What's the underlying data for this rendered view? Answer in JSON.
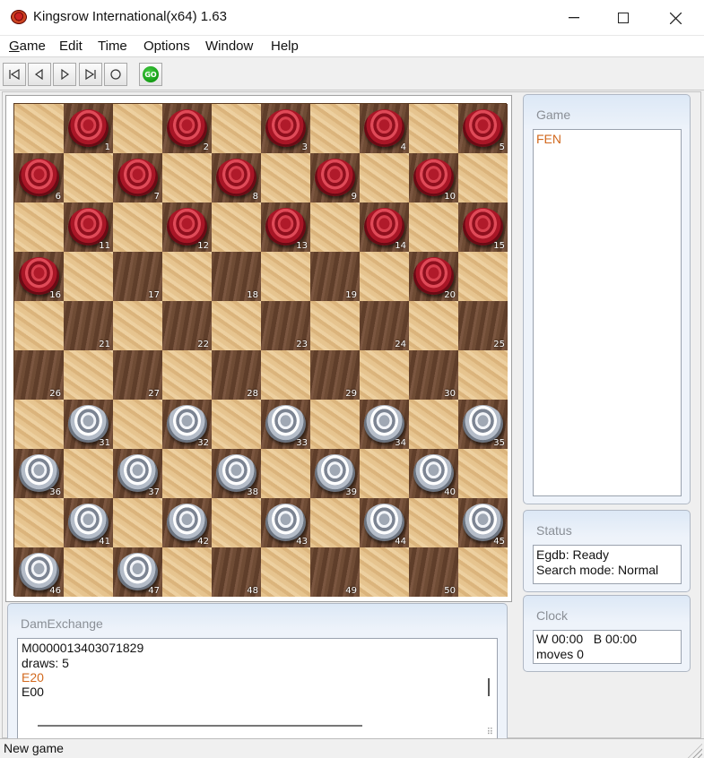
{
  "window": {
    "title": "Kingsrow International(x64) 1.63"
  },
  "menu": [
    "Game",
    "Edit",
    "Time",
    "Options",
    "Window",
    "Help"
  ],
  "toolbar": {
    "go_label": "GO"
  },
  "board": {
    "pieces": {
      "1": "red",
      "2": "red",
      "3": "red",
      "4": "red",
      "5": "red",
      "6": "red",
      "7": "red",
      "8": "red",
      "9": "red",
      "10": "red",
      "11": "red",
      "12": "red",
      "13": "red",
      "14": "red",
      "15": "red",
      "16": "red",
      "20": "red",
      "31": "white",
      "32": "white",
      "33": "white",
      "34": "white",
      "35": "white",
      "36": "white",
      "37": "white",
      "38": "white",
      "39": "white",
      "40": "white",
      "41": "white",
      "42": "white",
      "43": "white",
      "44": "white",
      "45": "white",
      "46": "white",
      "47": "white"
    }
  },
  "game_panel": {
    "title": "Game",
    "fen": "FEN"
  },
  "status_panel": {
    "title": "Status",
    "egdb": "Egdb: Ready",
    "search": "Search mode: Normal"
  },
  "clock_panel": {
    "title": "Clock",
    "time": "W 00:00   B 00:00",
    "moves": "moves 0"
  },
  "damexchange": {
    "title": "DamExchange",
    "line1": "M0000013403071829",
    "line2": "draws: 5",
    "line3": "E20",
    "line4": "E00"
  },
  "statusbar": {
    "text": "New game"
  },
  "colors": {
    "accent_orange": "#d2691e",
    "piece_red": "#b01a2a",
    "piece_white": "#e8ecf2"
  }
}
